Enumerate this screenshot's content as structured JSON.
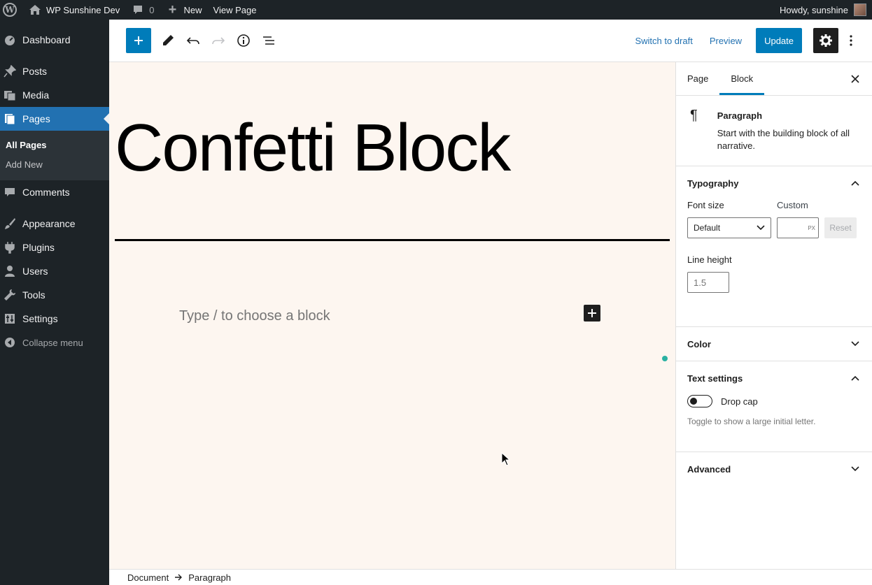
{
  "adminbar": {
    "site_name": "WP Sunshine Dev",
    "comments_count": "0",
    "new_label": "New",
    "view_page_label": "View Page",
    "howdy": "Howdy, sunshine"
  },
  "sidebar": {
    "items": [
      {
        "label": "Dashboard",
        "icon": "dashboard-icon"
      },
      {
        "label": "Posts",
        "icon": "pin-icon"
      },
      {
        "label": "Media",
        "icon": "media-icon"
      },
      {
        "label": "Pages",
        "icon": "pages-icon"
      },
      {
        "label": "Comments",
        "icon": "comment-icon"
      },
      {
        "label": "Appearance",
        "icon": "brush-icon"
      },
      {
        "label": "Plugins",
        "icon": "plug-icon"
      },
      {
        "label": "Users",
        "icon": "user-icon"
      },
      {
        "label": "Tools",
        "icon": "wrench-icon"
      },
      {
        "label": "Settings",
        "icon": "settings-icon"
      }
    ],
    "submenu": [
      "All Pages",
      "Add New"
    ],
    "collapse_label": "Collapse menu"
  },
  "toolbar": {
    "switch_to_draft": "Switch to draft",
    "preview": "Preview",
    "update": "Update"
  },
  "canvas": {
    "title": "Confetti Block",
    "placeholder": "Type / to choose a block"
  },
  "footer": {
    "crumbs": [
      "Document",
      "Paragraph"
    ]
  },
  "panel": {
    "tabs": [
      "Page",
      "Block"
    ],
    "active_tab": "Block",
    "block_title": "Paragraph",
    "block_desc": "Start with the building block of all narrative.",
    "typography": {
      "title": "Typography",
      "font_size_label": "Font size",
      "custom_label": "Custom",
      "select_value": "Default",
      "unit": "PX",
      "reset": "Reset",
      "line_height_label": "Line height",
      "line_height_placeholder": "1.5"
    },
    "color_title": "Color",
    "text_settings": {
      "title": "Text settings",
      "drop_cap": "Drop cap",
      "help": "Toggle to show a large initial letter."
    },
    "advanced_title": "Advanced"
  },
  "colors": {
    "accent": "#007cba",
    "canvas_bg": "#fdf6f0",
    "admin_bg": "#1d2327"
  }
}
